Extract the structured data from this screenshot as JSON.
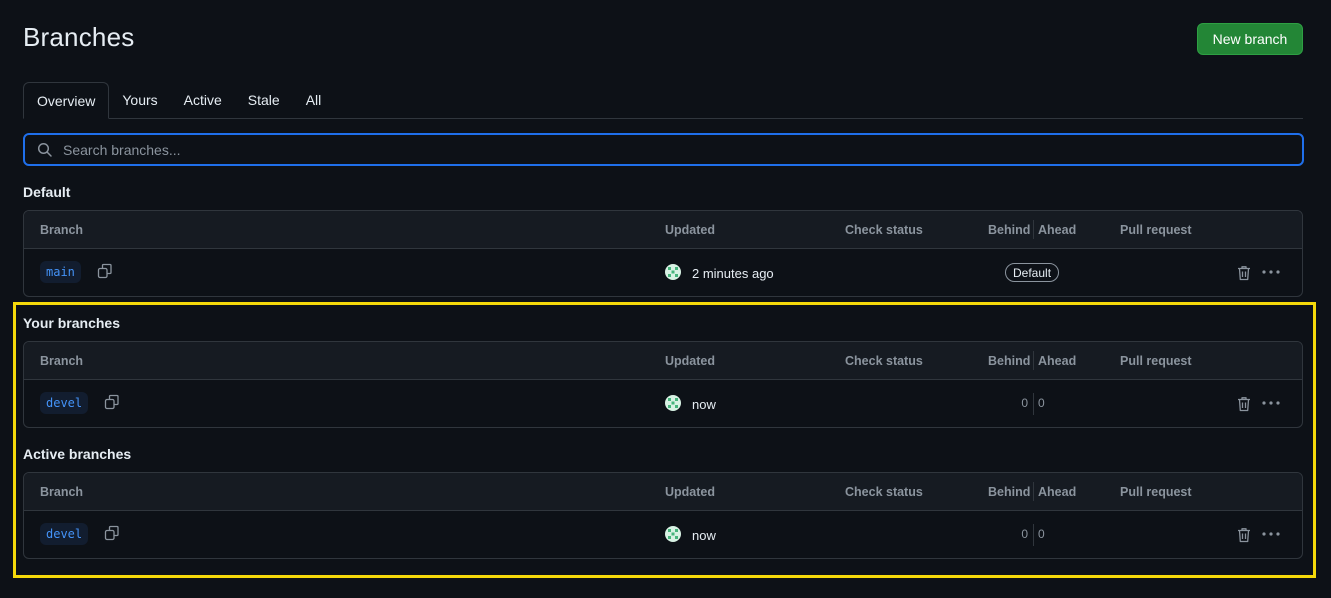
{
  "header": {
    "title": "Branches",
    "new_branch_label": "New branch"
  },
  "tabs": [
    {
      "label": "Overview",
      "selected": true
    },
    {
      "label": "Yours",
      "selected": false
    },
    {
      "label": "Active",
      "selected": false
    },
    {
      "label": "Stale",
      "selected": false
    },
    {
      "label": "All",
      "selected": false
    }
  ],
  "search": {
    "placeholder": "Search branches..."
  },
  "columns": {
    "branch": "Branch",
    "updated": "Updated",
    "check_status": "Check status",
    "behind": "Behind",
    "ahead": "Ahead",
    "pull_request": "Pull request"
  },
  "sections": {
    "default": {
      "title": "Default",
      "row": {
        "branch": "main",
        "updated": "2 minutes ago",
        "badge": "Default"
      }
    },
    "yours": {
      "title": "Your branches",
      "row": {
        "branch": "devel",
        "updated": "now",
        "behind": "0",
        "ahead": "0"
      }
    },
    "active": {
      "title": "Active branches",
      "row": {
        "branch": "devel",
        "updated": "now",
        "behind": "0",
        "ahead": "0"
      }
    }
  },
  "colors": {
    "accent": "#1f6feb",
    "primary_button": "#238636",
    "highlight": "#f5d90a",
    "link": "#4493f8"
  }
}
